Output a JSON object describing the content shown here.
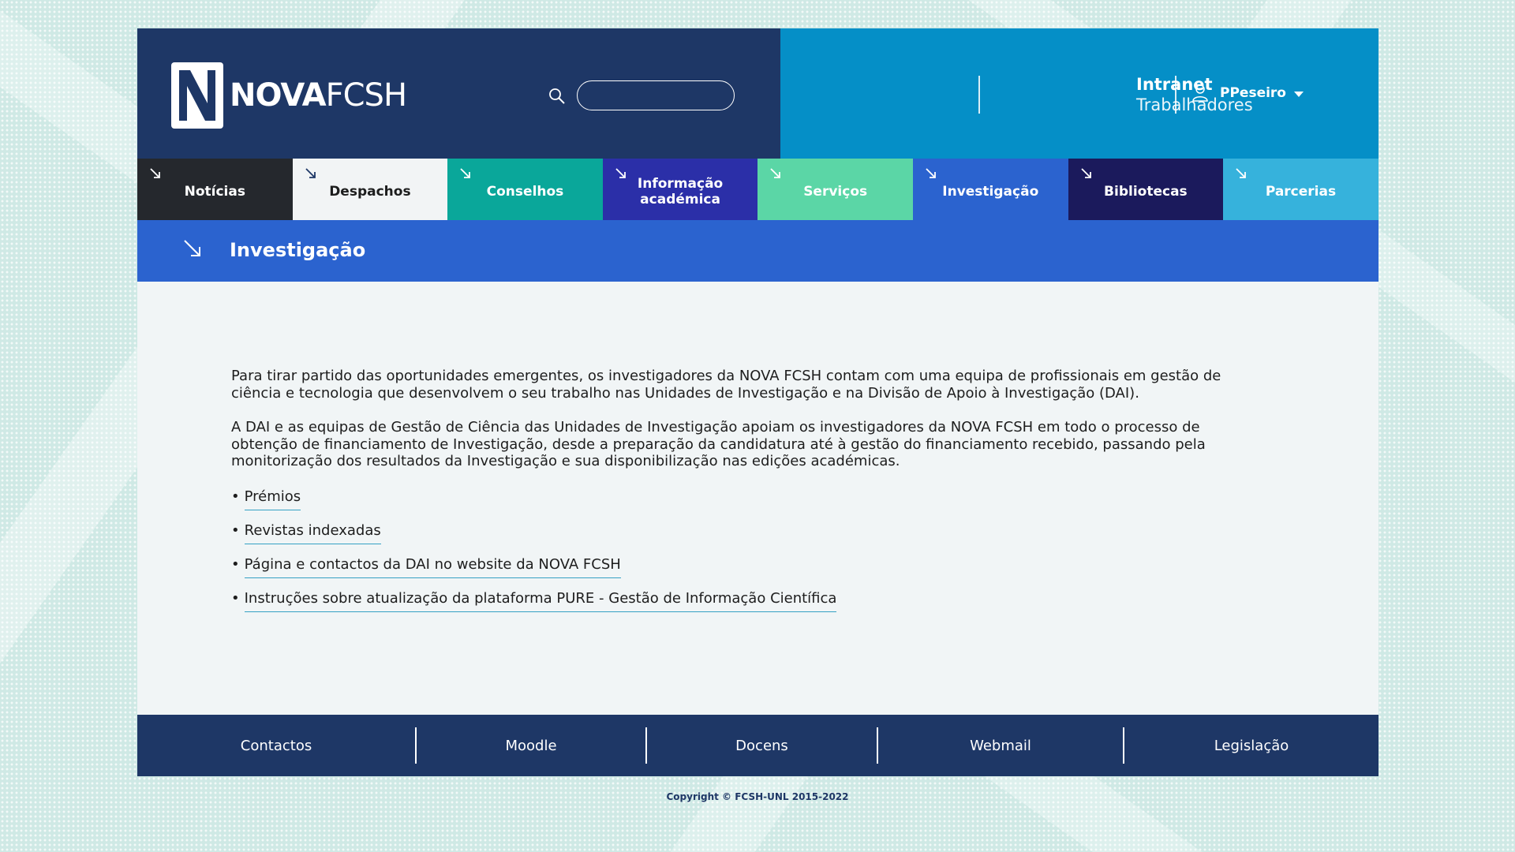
{
  "header": {
    "logo_text_bold": "NOVA",
    "logo_text_light": "FCSH",
    "search_placeholder": "",
    "intranet_title": "Intranet",
    "intranet_subtitle": "Trabalhadores",
    "user_name": "PPeseiro"
  },
  "nav": {
    "items": [
      {
        "label": "Notícias",
        "bg": "#25282d",
        "fg": "#ffffff",
        "arrow": "#ffffff"
      },
      {
        "label": "Despachos",
        "bg": "#f2f4f5",
        "fg": "#1d1d1d",
        "arrow": "#1e3766"
      },
      {
        "label": "Conselhos",
        "bg": "#0aa79a",
        "fg": "#ffffff",
        "arrow": "#ffffff"
      },
      {
        "label": "Informação académica",
        "bg": "#2b2fa8",
        "fg": "#ffffff",
        "arrow": "#ffffff"
      },
      {
        "label": "Serviços",
        "bg": "#5bd6a6",
        "fg": "#ffffff",
        "arrow": "#ffffff"
      },
      {
        "label": "Investigação",
        "bg": "#2b63cf",
        "fg": "#ffffff",
        "arrow": "#ffffff"
      },
      {
        "label": "Bibliotecas",
        "bg": "#1b1a5c",
        "fg": "#ffffff",
        "arrow": "#ffffff"
      },
      {
        "label": "Parcerias",
        "bg": "#36b2dc",
        "fg": "#ffffff",
        "arrow": "#ffffff"
      }
    ]
  },
  "page": {
    "title": "Investigação",
    "paragraph1": "Para tirar partido das oportunidades emergentes, os investigadores da NOVA FCSH contam com uma equipa de profissionais em gestão de ciência e tecnologia que desenvolvem o seu trabalho nas Unidades de Investigação e na Divisão de Apoio à Investigação (DAI).",
    "paragraph2": "A DAI e as equipas de Gestão de Ciência das Unidades de Investigação apoiam os investigadores da NOVA FCSH em todo o processo de obtenção de financiamento de Investigação, desde a preparação da candidatura até à gestão do financiamento recebido, passando pela monitorização dos resultados da Investigação e sua disponibilização nas edições académicas.",
    "bullet": "•",
    "links": [
      "Prémios",
      "Revistas indexadas",
      "Página e contactos da DAI no website da NOVA FCSH",
      "Instruções sobre atualização da plataforma PURE - Gestão de Informação Científica"
    ]
  },
  "footer": {
    "items": [
      "Contactos",
      "Moodle",
      "Docens",
      "Webmail",
      "Legislação"
    ],
    "copyright": "Copyright © FCSH-UNL 2015-2022"
  },
  "colors": {
    "header_dark": "#1e3766",
    "header_blue": "#058fc7",
    "title_blue": "#2b63cf",
    "link_underline": "#35a1c4"
  }
}
